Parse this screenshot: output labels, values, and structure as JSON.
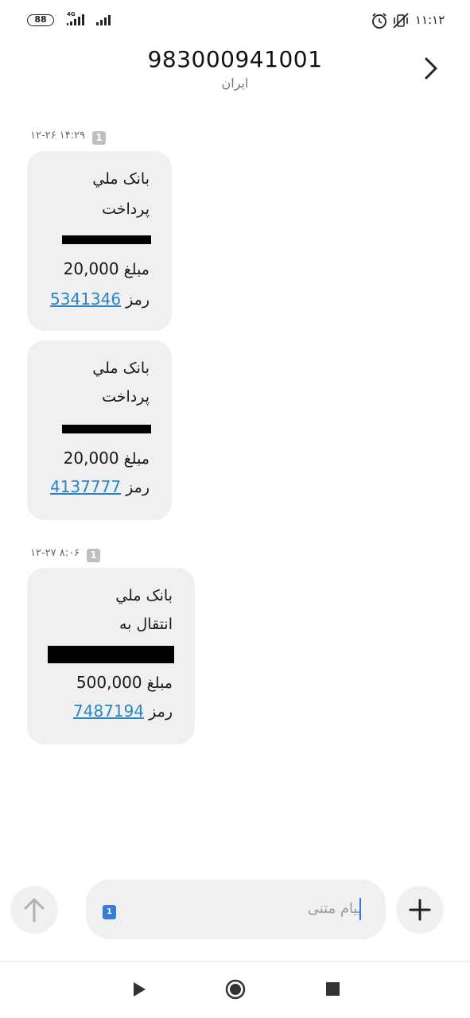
{
  "status_bar": {
    "battery": "88",
    "network_label": "4G",
    "time": "۱۱:۱۲"
  },
  "header": {
    "title": "983000941001",
    "subtitle": "ایران"
  },
  "groups": [
    {
      "date": "۱۲-۲۶ ۱۴:۲۹",
      "sim": "1",
      "messages": [
        {
          "line1": "بانک ملي",
          "line2": "پرداخت",
          "amount_label": "مبلغ",
          "amount": "20,000",
          "code_label": "رمز",
          "code": "5341346"
        },
        {
          "line1": "بانک ملي",
          "line2": "پرداخت",
          "amount_label": "مبلغ",
          "amount": "20,000",
          "code_label": "رمز",
          "code": "4137777"
        }
      ]
    },
    {
      "date": "۱۲-۲۷ ۸:۰۶",
      "sim": "1",
      "messages": [
        {
          "line1": "بانک ملي",
          "line2": "انتقال به",
          "amount_label": "مبلغ",
          "amount": "500,000",
          "code_label": "رمز",
          "code": "7487194"
        }
      ]
    }
  ],
  "composer": {
    "placeholder": "پیام متنی",
    "sim": "1"
  },
  "icons": {
    "scroll_up": "arrow-up-icon",
    "add": "plus-icon",
    "back": "chevron-right-icon",
    "nav_back": "triangle-icon",
    "nav_home": "circle-icon",
    "nav_recents": "square-icon"
  }
}
